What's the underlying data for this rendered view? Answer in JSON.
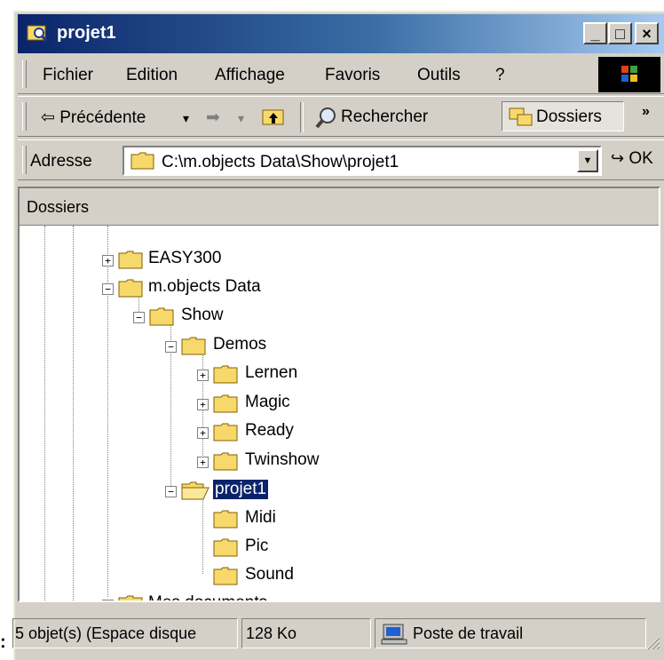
{
  "window": {
    "title": "projet1"
  },
  "title_buttons": {
    "minimize": "_",
    "maximize": "□",
    "close": "×"
  },
  "menu": {
    "items": [
      {
        "label": "Fichier",
        "key": "F"
      },
      {
        "label": "Edition",
        "key": "E"
      },
      {
        "label": "Affichage",
        "key": "h"
      },
      {
        "label": "Favoris",
        "key": "y"
      },
      {
        "label": "Outils",
        "key": "O"
      },
      {
        "label": "?",
        "key": "?"
      }
    ]
  },
  "toolbar": {
    "back_label": "⇦ Précédente",
    "back_arrow": "▾",
    "forward_arrow": "➡",
    "forward_drop": "▾",
    "search_label": "Rechercher",
    "folders_label": "Dossiers",
    "more": "»"
  },
  "address": {
    "label": "Adresse",
    "value": "C:\\m.objects Data\\Show\\projet1",
    "go_label": "OK"
  },
  "folders_pane": {
    "title": "Dossiers",
    "tree": [
      {
        "label": "EASY300",
        "level": 2,
        "expander": "+"
      },
      {
        "label": "m.objects Data",
        "level": 2,
        "expander": "−"
      },
      {
        "label": "Show",
        "level": 3,
        "expander": "−"
      },
      {
        "label": "Demos",
        "level": 4,
        "expander": "−"
      },
      {
        "label": "Lernen",
        "level": 5,
        "expander": "+"
      },
      {
        "label": "Magic",
        "level": 5,
        "expander": "+"
      },
      {
        "label": "Ready",
        "level": 5,
        "expander": "+"
      },
      {
        "label": "Twinshow",
        "level": 5,
        "expander": "+"
      },
      {
        "label": "projet1",
        "level": 4,
        "expander": "−",
        "selected": true,
        "open": true
      },
      {
        "label": "Midi",
        "level": 5,
        "expander": ""
      },
      {
        "label": "Pic",
        "level": 5,
        "expander": ""
      },
      {
        "label": "Sound",
        "level": 5,
        "expander": ""
      },
      {
        "label": "Mes documents",
        "level": 2,
        "expander": "+"
      }
    ]
  },
  "status": {
    "objects": "5 objet(s) (Espace disque",
    "size": "128 Ko",
    "location": "Poste de travail"
  },
  "colors": {
    "title_gradient_start": "#0a246a",
    "title_gradient_end": "#a6caf0",
    "folder_yellow": "#f7d96b",
    "selection": "#0a246a"
  }
}
